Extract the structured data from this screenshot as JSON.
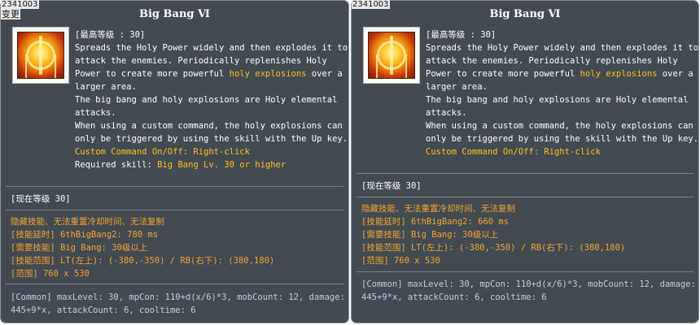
{
  "left": {
    "skill_id": "2341003",
    "change_label": "变更",
    "title": "Big Bang Ⅵ",
    "max_level": "[最高等级 : 30]",
    "desc_lines": [
      "Spreads the Holy Power widely and then explodes it to",
      "attack the enemies. Periodically replenishes Holy"
    ],
    "desc_line3_prefix": "Power to create more powerful ",
    "desc_line3_highlight": "holy explosions",
    "desc_line3_suffix": " over a",
    "desc_lines_b": [
      "larger area.",
      "The big bang and holy explosions are Holy elemental",
      "attacks.",
      "When using a custom command, the holy explosions can",
      "only be triggered by using the skill with the Up key."
    ],
    "custom_command": "Custom Command On/Off: Right-click",
    "required_label": "Required skill: ",
    "required_value": "Big Bang Lv. 30 or higher",
    "current_level": "[现在等级 30]",
    "hidden_note": "隐藏技能、无法重置冷却时间、无法复制",
    "stats": [
      "[技能延时] 6thBigBang2: 780 ms",
      "[需要技能] Big Bang: 30级以上",
      "[技能范围] LT(左上): (-380,-350) / RB(右下): (380,180)",
      "[范围] 760 x 530"
    ],
    "common_line1": "[Common] maxLevel: 30, mpCon: 110+d(x/6)*3, mobCount: 12, damage:",
    "common_line2": "445+9*x, attackCount: 6, cooltime: 6"
  },
  "right": {
    "skill_id": "2341003",
    "title": "Big Bang Ⅵ",
    "max_level": "[最高等级 : 30]",
    "desc_lines": [
      "Spreads the Holy Power widely and then explodes it to",
      "attack the enemies. Periodically replenishes Holy"
    ],
    "desc_line3_prefix": "Power to create more powerful ",
    "desc_line3_highlight": "holy explosions",
    "desc_line3_suffix": " over a",
    "desc_lines_b": [
      "larger area.",
      "The big bang and holy explosions are Holy elemental",
      "attacks.",
      "When using a custom command, the holy explosions can",
      "only be triggered by using the skill with the Up key."
    ],
    "custom_command": "Custom Command On/Off: Right-click",
    "current_level": "[现在等级 30]",
    "hidden_note": "隐藏技能、无法重置冷却时间、无法复制",
    "stats": [
      "[技能延时] 6thBigBang2: 660 ms",
      "[需要技能] Big Bang: 30级以上",
      "[技能范围] LT(左上): (-380,-350) / RB(右下): (380,180)",
      "[范围] 760 x 530"
    ],
    "common_line1": "[Common] maxLevel: 30, mpCon: 110+d(x/6)*3, mobCount: 12, damage:",
    "common_line2": "445+9*x, attackCount: 6, cooltime: 6"
  },
  "colors": {
    "panel_bg": "#424a52",
    "highlight": "#ffc21a",
    "stat_text": "#f7a330",
    "common_text": "#c8cbe0"
  },
  "icons": {
    "skill": "big-bang-skill-icon"
  }
}
